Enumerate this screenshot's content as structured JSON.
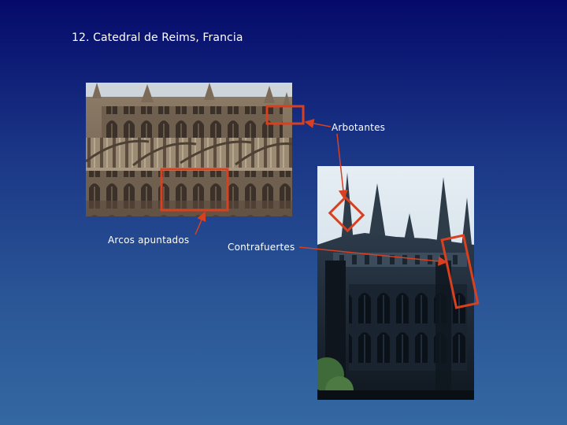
{
  "slide": {
    "title": "12. Catedral de Reims, Francia"
  },
  "labels": {
    "arbotantes": "Arbotantes",
    "arcos": "Arcos apuntados",
    "contrafuertes": "Contrafuertes"
  },
  "colors": {
    "annotation": "#d9401f",
    "text": "#ffffff"
  }
}
